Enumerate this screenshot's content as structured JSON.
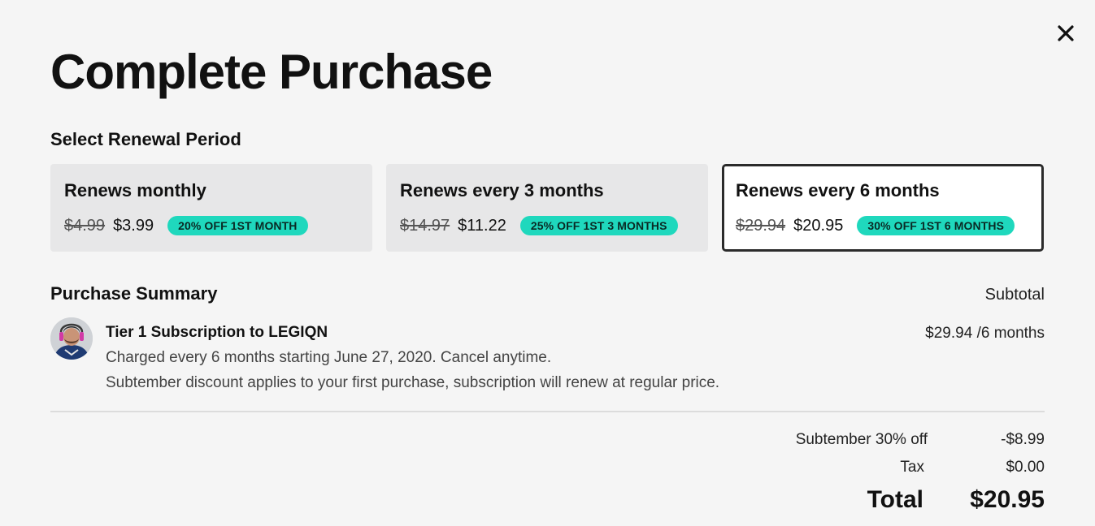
{
  "modal": {
    "title": "Complete Purchase",
    "close_icon": "close-icon"
  },
  "renewal": {
    "label": "Select Renewal Period",
    "options": [
      {
        "title": "Renews monthly",
        "old_price": "$4.99",
        "new_price": "$3.99",
        "badge": "20% OFF 1ST MONTH",
        "selected": false
      },
      {
        "title": "Renews every 3 months",
        "old_price": "$14.97",
        "new_price": "$11.22",
        "badge": "25% OFF 1ST 3 MONTHS",
        "selected": false
      },
      {
        "title": "Renews every 6 months",
        "old_price": "$29.94",
        "new_price": "$20.95",
        "badge": "30% OFF 1ST 6 MONTHS",
        "selected": true
      }
    ]
  },
  "summary": {
    "label": "Purchase Summary",
    "subtotal_header": "Subtotal",
    "item": {
      "title": "Tier 1 Subscription to LEGIQN",
      "line1": "Charged every 6 months starting June 27, 2020. Cancel anytime.",
      "line2": "Subtember discount applies to your first purchase, subscription will renew at regular price.",
      "price": "$29.94 /6 months"
    },
    "rows": [
      {
        "label": "Subtember 30% off",
        "value": "-$8.99"
      },
      {
        "label": "Tax",
        "value": "$0.00"
      }
    ],
    "total_label": "Total",
    "total_value": "$20.95"
  },
  "colors": {
    "accent": "#1fd8bd",
    "background": "#f5f5f5",
    "card": "#e7e7e8",
    "selected_border": "#2b2b2b"
  }
}
